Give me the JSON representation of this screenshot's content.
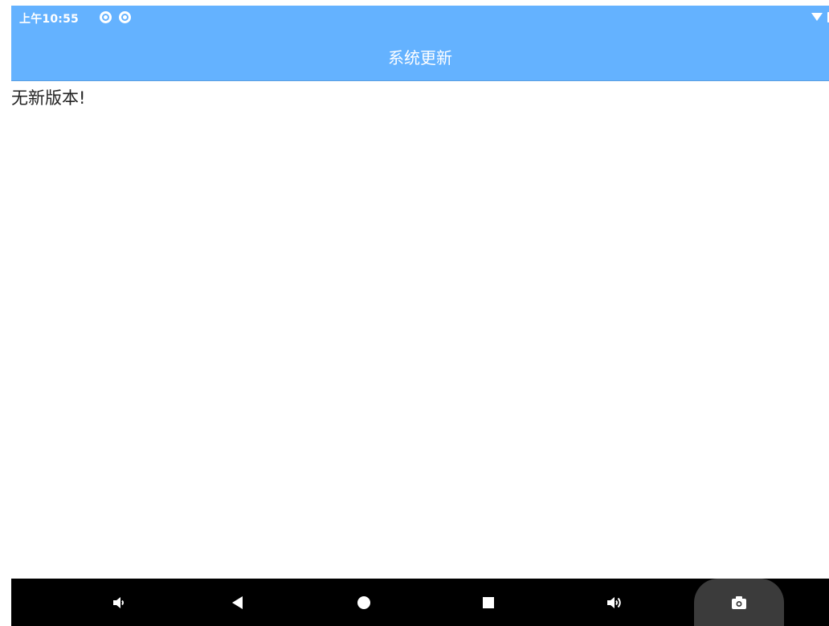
{
  "status_bar": {
    "time": "上午10:55",
    "notification_icons": [
      "notification-circle-icon",
      "notification-circle-icon"
    ],
    "right_icons": [
      "wifi-icon",
      "battery-icon"
    ]
  },
  "app_bar": {
    "title": "系统更新",
    "background_color": "#64b2ff"
  },
  "content": {
    "message": "无新版本!"
  },
  "nav_bar": {
    "buttons": [
      {
        "name": "volume-down",
        "icon": "volume-down-icon"
      },
      {
        "name": "back",
        "icon": "back-triangle-icon"
      },
      {
        "name": "home",
        "icon": "home-circle-icon"
      },
      {
        "name": "recents",
        "icon": "recents-square-icon"
      },
      {
        "name": "volume-up",
        "icon": "volume-up-icon"
      },
      {
        "name": "screenshot",
        "icon": "camera-icon"
      }
    ],
    "background_color": "#000000"
  }
}
